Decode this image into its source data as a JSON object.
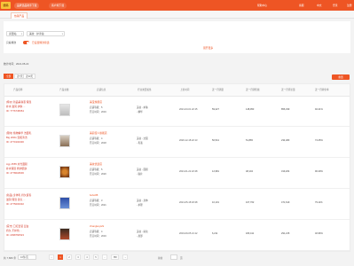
{
  "header": {
    "logo": "优码",
    "nav": [
      "品牌选品助手下载",
      "客户端下载"
    ],
    "links": [
      "帮助中心",
      "客服",
      "中文",
      "登录",
      "注册"
    ]
  },
  "tabs": [
    "热销产品"
  ],
  "filters": {
    "site": "泰国站",
    "category": "美妆 · 护手霜",
    "toggle_label": "只看爆款",
    "toggle_note": "已设置爆款筛选",
    "expand": "展开更多"
  },
  "date_text": "统计时间：2021-05-22",
  "view_tabs": [
    "全部",
    "近7天",
    "近30天"
  ],
  "reset_label": "重置",
  "table": {
    "headers": [
      "产品名称",
      "产品主图",
      "店铺信息",
      "行业类目属性",
      "上架时间",
      "近一月销量",
      "近一月销售额",
      "近一月评论量",
      "近一月转化率",
      "近一月增长率"
    ],
    "rows": [
      {
        "name": [
          "[特价] 新品美容液 保湿",
          "补水 滋润 护肤 ...",
          "ID: 7776745654"
        ],
        "shop": "美宝旗舰店",
        "shop_info": [
          "店铺等级：5",
          "开店时间：2019"
        ],
        "category": [
          "美妆 - 护肤",
          "- 精华"
        ],
        "date": "2021-03-01 22:15",
        "sales": "59,227",
        "revenue": "148,953",
        "reviews": "856,339",
        "conv": "92.21%",
        "growth": "+12.5%"
      },
      {
        "name": [
          "[限时] 植物精华 洁面乳",
          "Big 200G 温和清洁",
          "ID: 4770102300"
        ],
        "shop": "美丽佳人旗舰店",
        "shop_info": [
          "店铺等级：4",
          "开店时间：2018"
        ],
        "category": [
          "美妆 - 洁面",
          "- 乳液"
        ],
        "date": "2020-12-18 22:13",
        "sales": "50,541",
        "revenue": "51,865",
        "reviews": "234,483",
        "conv": "74.25%",
        "growth": "+8.1%"
      },
      {
        "name": [
          "Agy 4555 水光面膜",
          "补水保湿 修护肌肤",
          "ID: 4778018006"
        ],
        "shop": "美妆优选店",
        "shop_info": [
          "店铺等级：5",
          "开店时间：2020"
        ],
        "category": [
          "美妆 - 面膜",
          "- 贴片"
        ],
        "date": "2021-01-22 22:28",
        "sales": "12,981",
        "revenue": "48,104",
        "reviews": "319,204",
        "conv": "90.29%",
        "growth": "+21.0%"
      },
      {
        "name": [
          "[新品] 身体乳 持久留香",
          "滋润 保湿 香氛 ...",
          "ID: 4775003302"
        ],
        "shop": "bobo88",
        "shop_info": [
          "店铺等级：3",
          "开店时间：2021"
        ],
        "category": [
          "美妆 - 身体",
          "- 护理"
        ],
        "date": "2021-05-18 18:28",
        "sales": "10,101",
        "revenue": "107,762",
        "reviews": "471,619",
        "conv": "79.11%",
        "growth": "+5.4%"
      },
      {
        "name": [
          "[官方] 口红套装 显白",
          "持久 不掉色 ...",
          "ID: 2398760523"
        ],
        "shop": "zhangkeyishi",
        "shop_info": [
          "店铺等级：4",
          "开店时间：2019"
        ],
        "category": [
          "美妆 - 彩妆",
          "- 唇部"
        ],
        "date": "2019-09-05 21:12",
        "sales": "6,211",
        "revenue": "183,411",
        "reviews": "291,215",
        "conv": "40.96%",
        "growth": "+3.2%"
      }
    ]
  },
  "pagination": {
    "total": "共 7,880 条",
    "page_size": "10条/页",
    "pages": [
      "1",
      "2",
      "3",
      "4",
      "5",
      "...",
      "788"
    ],
    "goto": "前往",
    "page_word": "页"
  },
  "colors": {
    "accent": "#ee5524",
    "gold": "#f7c33a"
  }
}
